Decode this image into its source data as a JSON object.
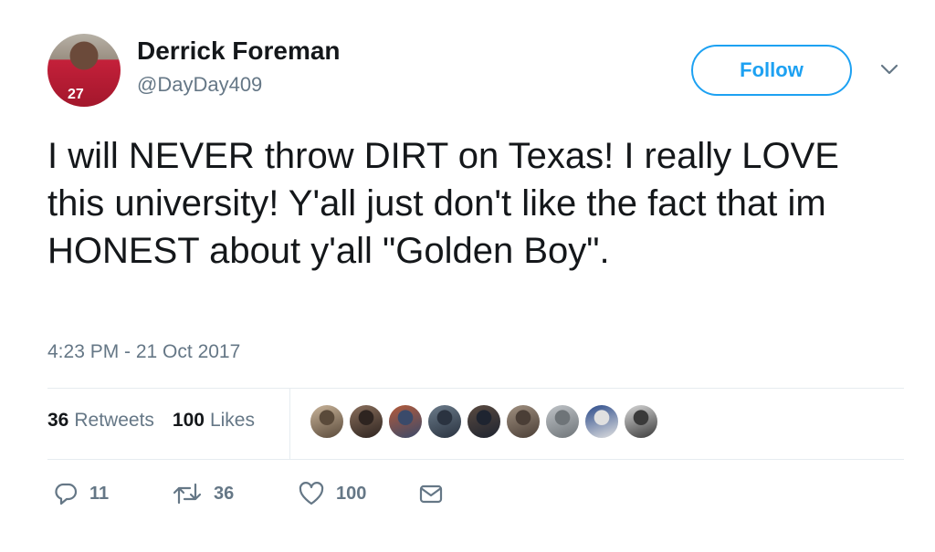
{
  "author": {
    "name": "Derrick Foreman",
    "handle": "@DayDay409",
    "avatar_icon": "avatar-photo"
  },
  "follow_button": {
    "label": "Follow"
  },
  "menu": {
    "icon": "chevron-down-icon"
  },
  "tweet": {
    "text": "I will NEVER throw DIRT on Texas! I really LOVE this university! Y'all just don't like the fact that im HONEST about y'all \"Golden Boy\".",
    "timestamp": "4:23 PM - 21 Oct 2017"
  },
  "stats": {
    "retweets_count": "36",
    "retweets_label": "Retweets",
    "likes_count": "100",
    "likes_label": "Likes"
  },
  "likers": [
    {
      "color_a": "#c9b49a",
      "color_b": "#5a4a3a"
    },
    {
      "color_a": "#8a6f5c",
      "color_b": "#2e2420"
    },
    {
      "color_a": "#b45a3a",
      "color_b": "#3a4a6a"
    },
    {
      "color_a": "#6b7b8a",
      "color_b": "#2a3340"
    },
    {
      "color_a": "#5a4a40",
      "color_b": "#1e2430"
    },
    {
      "color_a": "#a09080",
      "color_b": "#4a3e36"
    },
    {
      "color_a": "#c0c4c8",
      "color_b": "#6e7478"
    },
    {
      "color_a": "#2a4a8a",
      "color_b": "#e0e0e0"
    },
    {
      "color_a": "#d8d8d8",
      "color_b": "#3a3a3a"
    }
  ],
  "actions": {
    "reply_count": "11",
    "retweet_count": "36",
    "like_count": "100",
    "reply_icon": "reply-icon",
    "retweet_icon": "retweet-icon",
    "like_icon": "heart-icon",
    "dm_icon": "envelope-icon"
  },
  "colors": {
    "accent": "#1da1f2",
    "text": "#14171a",
    "muted": "#657786",
    "divider": "#e6ecf0"
  }
}
